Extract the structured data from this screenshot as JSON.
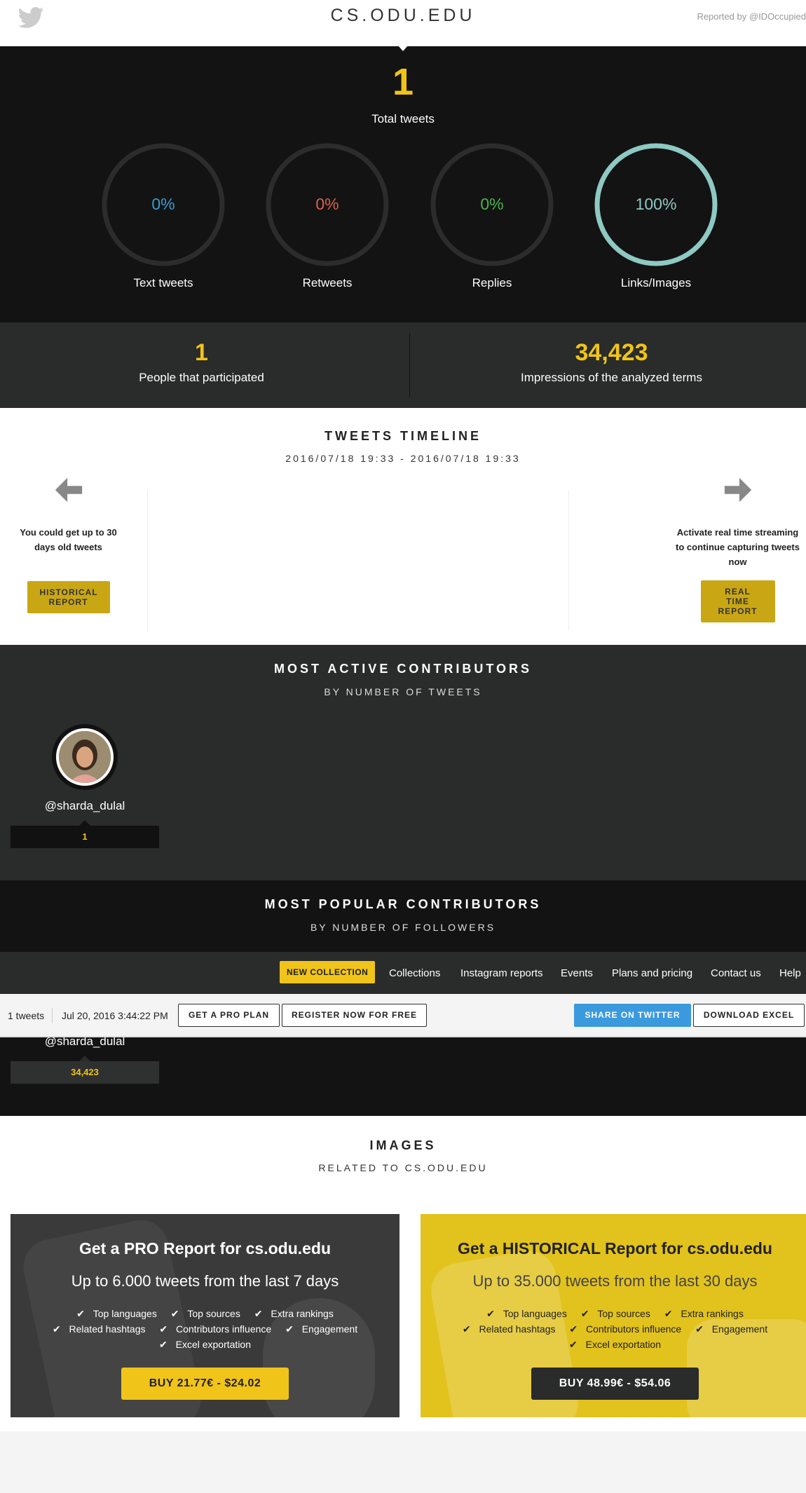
{
  "header": {
    "site_title": "CS.ODU.EDU",
    "reported_by": "Reported by @IDOccupied"
  },
  "totals": {
    "total_tweets": "1",
    "total_label": "Total tweets"
  },
  "breakdown": [
    {
      "label": "Text tweets",
      "percent_text": "0%",
      "percent": 0,
      "color": "#3a9dd3"
    },
    {
      "label": "Retweets",
      "percent_text": "0%",
      "percent": 0,
      "color": "#d9624a"
    },
    {
      "label": "Replies",
      "percent_text": "0%",
      "percent": 0,
      "color": "#4bb44b"
    },
    {
      "label": "Links/Images",
      "percent_text": "100%",
      "percent": 100,
      "color": "#8ec9c3"
    }
  ],
  "participation": {
    "people_count": "1",
    "people_label": "People that participated",
    "impressions_count": "34,423",
    "impressions_label": "Impressions of the analyzed terms"
  },
  "timeline": {
    "title": "TWEETS TIMELINE",
    "range": "2016/07/18 19:33 - 2016/07/18 19:33",
    "left_text": "You could get up to 30 days old tweets",
    "left_button": "HISTORICAL REPORT",
    "right_text": "Activate real time streaming to continue capturing tweets now",
    "right_button": "REAL TIME REPORT"
  },
  "active_contributors": {
    "title": "MOST ACTIVE CONTRIBUTORS",
    "subtitle": "BY NUMBER OF TWEETS",
    "handle": "@sharda_dulal",
    "count": "1"
  },
  "popular_contributors": {
    "title": "MOST POPULAR CONTRIBUTORS",
    "subtitle": "BY NUMBER OF FOLLOWERS",
    "handle": "@sharda_dulal",
    "count": "34,423"
  },
  "nav": {
    "new_collection": "NEW COLLECTION",
    "items": [
      "Collections",
      "Instagram reports",
      "Events",
      "Plans and pricing",
      "Contact us",
      "Help"
    ]
  },
  "action_bar": {
    "tweets": "1 tweets",
    "date": "Jul 20, 2016 3:44:22 PM",
    "pro_plan": "GET A PRO PLAN",
    "register": "REGISTER NOW FOR FREE",
    "share": "SHARE ON TWITTER",
    "download": "DOWNLOAD EXCEL"
  },
  "images": {
    "title": "IMAGES",
    "subtitle": "RELATED TO CS.ODU.EDU"
  },
  "pro_card": {
    "title": "Get a PRO Report for cs.odu.edu",
    "subtitle": "Up to 6.000 tweets from the last 7 days",
    "features": [
      "Top languages",
      "Top sources",
      "Extra rankings",
      "Related hashtags",
      "Contributors influence",
      "Engagement",
      "Excel exportation"
    ],
    "button": "BUY 21.77€ - $24.02"
  },
  "historical_card": {
    "title": "Get a HISTORICAL Report for cs.odu.edu",
    "subtitle": "Up to 35.000 tweets from the last 30 days",
    "features": [
      "Top languages",
      "Top sources",
      "Extra rankings",
      "Related hashtags",
      "Contributors influence",
      "Engagement",
      "Excel exportation"
    ],
    "button": "BUY 48.99€ - $54.06"
  }
}
